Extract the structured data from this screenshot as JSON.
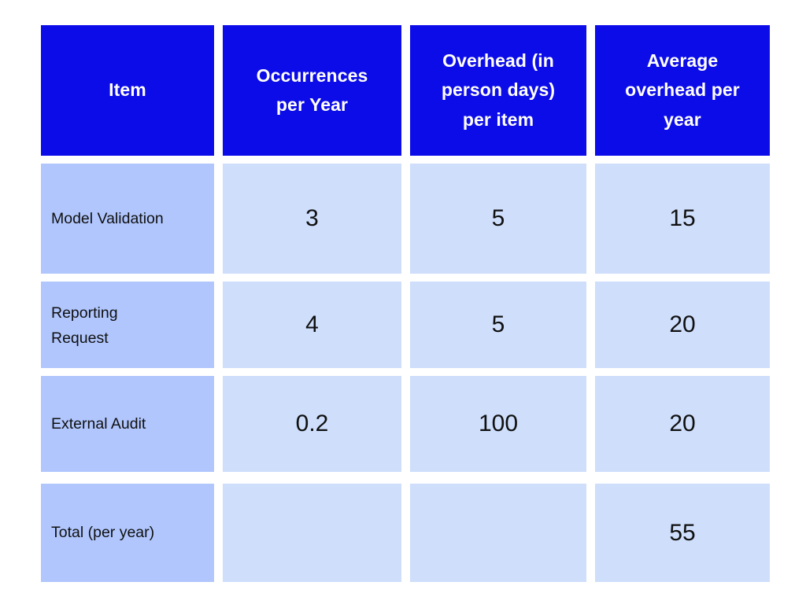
{
  "table": {
    "columns": [
      {
        "key": "item",
        "header": "Item",
        "align": "center"
      },
      {
        "key": "occurrences",
        "header": "Occurrences\nper Year",
        "align": "center"
      },
      {
        "key": "overhead_per_item",
        "header": "Overhead (in\nperson days)\nper item",
        "align": "center"
      },
      {
        "key": "avg_overhead",
        "header": "Average\noverhead per\nyear",
        "align": "center"
      }
    ],
    "rows": [
      {
        "item": "Model Validation",
        "occurrences": "3",
        "overhead_per_item": "5",
        "avg_overhead": "15"
      },
      {
        "item": "Reporting\nRequest",
        "occurrences": "4",
        "overhead_per_item": "5",
        "avg_overhead": "20"
      },
      {
        "item": "External Audit",
        "occurrences": "0.2",
        "overhead_per_item": "100",
        "avg_overhead": "20"
      },
      {
        "item": "Total (per year)",
        "occurrences": "",
        "overhead_per_item": "",
        "avg_overhead": "55"
      }
    ]
  },
  "colors": {
    "header_background": "#0c0ce8",
    "header_text": "#ffffff",
    "label_cell_background": "#b0c6fd",
    "value_cell_background": "#cedefb",
    "body_text": "#101010",
    "page_background": "#ffffff"
  }
}
